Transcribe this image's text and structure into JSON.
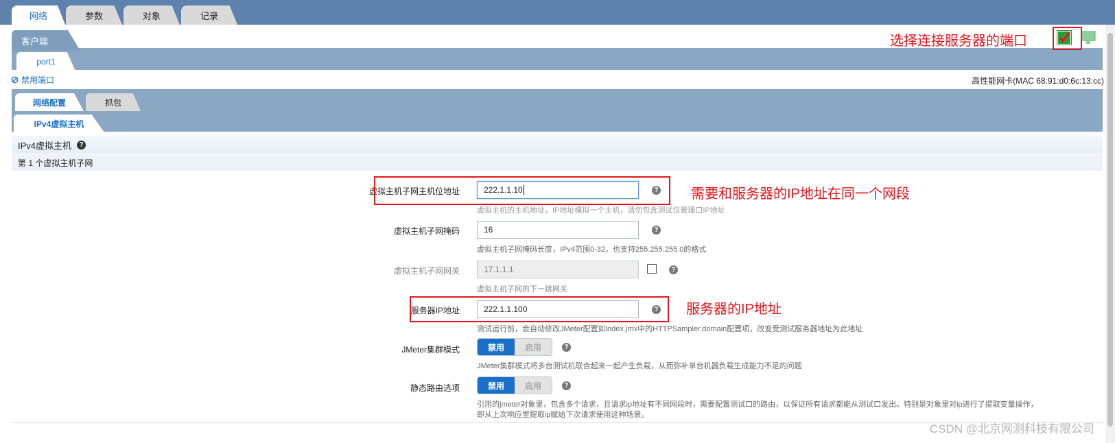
{
  "top_tabs": [
    {
      "label": "网络",
      "active": true
    },
    {
      "label": "参数",
      "active": false
    },
    {
      "label": "对象",
      "active": false
    },
    {
      "label": "记录",
      "active": false
    }
  ],
  "client_tab": "客户端",
  "port_tab": "port1",
  "disable_port": "禁用端口",
  "nic_info": "高性能网卡(MAC 68:91:d0:6c:13:cc)",
  "config_tabs": [
    {
      "label": "网络配置",
      "active": true
    },
    {
      "label": "抓包",
      "active": false
    }
  ],
  "ipv4_tab": "IPv4虚拟主机",
  "section_title": "IPv4虚拟主机",
  "subnet_title": "第 1 个虚拟主机子网",
  "fields": {
    "host_ip": {
      "label": "虚拟主机子网主机位地址",
      "value": "222.1.1.10",
      "hint": "虚拟主机的主机地址，IP地址模拟一个主机，请勿包含测试仪管理口IP地址"
    },
    "mask": {
      "label": "虚拟主机子网掩码",
      "value": "16",
      "hint": "虚拟主机子网掩码长度，IPv4范围0-32，也支持255.255.255.0的格式"
    },
    "gateway": {
      "label": "虚拟主机子网网关",
      "value": "17.1.1.1",
      "hint": "虚拟主机子网的下一跳网关"
    },
    "server_ip": {
      "label": "服务器IP地址",
      "value": "222.1.1.100",
      "hint": "测试运行前，会自动修改JMeter配置如index.jmx中的HTTPSampler.domain配置项，改变受测试服务器地址为此地址"
    },
    "jmeter_cluster": {
      "label": "JMeter集群模式",
      "on": "禁用",
      "off": "启用",
      "hint": "JMeter集群模式将多台测试机联合起来一起产生负载，从而弥补单台机器负载生成能力不足的问题"
    },
    "static_route": {
      "label": "静态路由选项",
      "on": "禁用",
      "off": "启用",
      "hint1": "引用的jmeter对象里，包含多个请求，且请求ip地址有不同网段时，需要配置测试口的路由，以保证所有请求都能从测试口发出。特别是对象里对ip进行了提取变量操作，",
      "hint2": "即从上次响应里提取ip赋给下次请求使用这种场景。"
    }
  },
  "annotations": {
    "port_select": "选择连接服务器的端口",
    "same_segment": "需要和服务器的IP地址在同一个网段",
    "server_ip": "服务器的IP地址"
  },
  "watermark": "CSDN @北京网测科技有限公司",
  "colors": {
    "accent": "#1a6fc9",
    "header": "#5d82ad",
    "strip": "#8aa7c4",
    "annotation": "#e8141a"
  },
  "help_glyph": "?"
}
